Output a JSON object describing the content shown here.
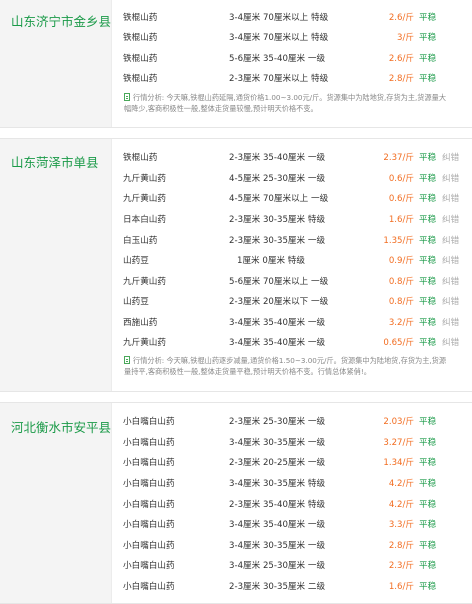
{
  "sections": [
    {
      "region": "山东济宁市金乡县",
      "rows": [
        {
          "name": "铁棍山药",
          "spec": "3-4厘米 70厘米以上 特级",
          "price": "2.6/斤",
          "trend": "平稳",
          "action": ""
        },
        {
          "name": "铁棍山药",
          "spec": "3-4厘米 70厘米以上 特级",
          "price": "3/斤",
          "trend": "平稳",
          "action": ""
        },
        {
          "name": "铁棍山药",
          "spec": "5-6厘米 35-40厘米 一级",
          "price": "2.6/斤",
          "trend": "平稳",
          "action": ""
        },
        {
          "name": "铁棍山药",
          "spec": "2-3厘米 70厘米以上 特级",
          "price": "2.8/斤",
          "trend": "平稳",
          "action": ""
        }
      ],
      "note_lines": [
        "行情分析: 今天嘛,铁棍山药延隔,通货价格1.00~3.00元/斤。货源集中为陆地货,存货为主,货源量大",
        "幅降少,客商积极性一般,整体走货量较慢,预计明天价格不变。"
      ]
    },
    {
      "region": "山东菏泽市单县",
      "rows": [
        {
          "name": "铁棍山药",
          "spec": "2-3厘米 35-40厘米 一级",
          "price": "2.37/斤",
          "trend": "平稳",
          "action": "纠错"
        },
        {
          "name": "九斤黄山药",
          "spec": "4-5厘米 25-30厘米 一级",
          "price": "0.6/斤",
          "trend": "平稳",
          "action": "纠错"
        },
        {
          "name": "九斤黄山药",
          "spec": "4-5厘米 70厘米以上 一级",
          "price": "0.6/斤",
          "trend": "平稳",
          "action": "纠错"
        },
        {
          "name": "日本白山药",
          "spec": "2-3厘米 30-35厘米 特级",
          "price": "1.6/斤",
          "trend": "平稳",
          "action": "纠错"
        },
        {
          "name": "白玉山药",
          "spec": "2-3厘米 30-35厘米 一级",
          "price": "1.35/斤",
          "trend": "平稳",
          "action": "纠错"
        },
        {
          "name": "山药豆",
          "spec": "1厘米 0厘米 特级",
          "price": "0.9/斤",
          "trend": "平稳",
          "action": "纠错"
        },
        {
          "name": "九斤黄山药",
          "spec": "5-6厘米 70厘米以上 一级",
          "price": "0.8/斤",
          "trend": "平稳",
          "action": "纠错"
        },
        {
          "name": "山药豆",
          "spec": "2-3厘米 20厘米以下 一级",
          "price": "0.8/斤",
          "trend": "平稳",
          "action": "纠错"
        },
        {
          "name": "西施山药",
          "spec": "3-4厘米 35-40厘米 一级",
          "price": "3.2/斤",
          "trend": "平稳",
          "action": "纠错"
        },
        {
          "name": "九斤黄山药",
          "spec": "3-4厘米 35-40厘米 一级",
          "price": "0.65/斤",
          "trend": "平稳",
          "action": "纠错"
        }
      ],
      "note_lines": [
        "行情分析: 今天嘛,铁棍山药逐步减量,通货价格1.50~3.00元/斤。货源集中为陆地货,存货为主,货源",
        "量持平,客商积极性一般,整体走货量平稳,预计明天价格不变。行情总体紧俏!。"
      ]
    },
    {
      "region": "河北衡水市安平县",
      "rows": [
        {
          "name": "小白嘴白山药",
          "spec": "2-3厘米 25-30厘米 一级",
          "price": "2.03/斤",
          "trend": "平稳",
          "action": ""
        },
        {
          "name": "小白嘴白山药",
          "spec": "3-4厘米 30-35厘米 一级",
          "price": "3.27/斤",
          "trend": "平稳",
          "action": ""
        },
        {
          "name": "小白嘴白山药",
          "spec": "2-3厘米 20-25厘米 一级",
          "price": "1.34/斤",
          "trend": "平稳",
          "action": ""
        },
        {
          "name": "小白嘴白山药",
          "spec": "3-4厘米 30-35厘米 特级",
          "price": "4.2/斤",
          "trend": "平稳",
          "action": ""
        },
        {
          "name": "小白嘴白山药",
          "spec": "2-3厘米 35-40厘米 特级",
          "price": "4.2/斤",
          "trend": "平稳",
          "action": ""
        },
        {
          "name": "小白嘴白山药",
          "spec": "3-4厘米 35-40厘米 一级",
          "price": "3.3/斤",
          "trend": "平稳",
          "action": ""
        },
        {
          "name": "小白嘴白山药",
          "spec": "3-4厘米 30-35厘米 一级",
          "price": "2.8/斤",
          "trend": "平稳",
          "action": ""
        },
        {
          "name": "小白嘴白山药",
          "spec": "3-4厘米 25-30厘米 一级",
          "price": "2.3/斤",
          "trend": "平稳",
          "action": ""
        },
        {
          "name": "小白嘴白山药",
          "spec": "2-3厘米 30-35厘米 二级",
          "price": "1.6/斤",
          "trend": "平稳",
          "action": ""
        }
      ],
      "note_lines": []
    }
  ]
}
